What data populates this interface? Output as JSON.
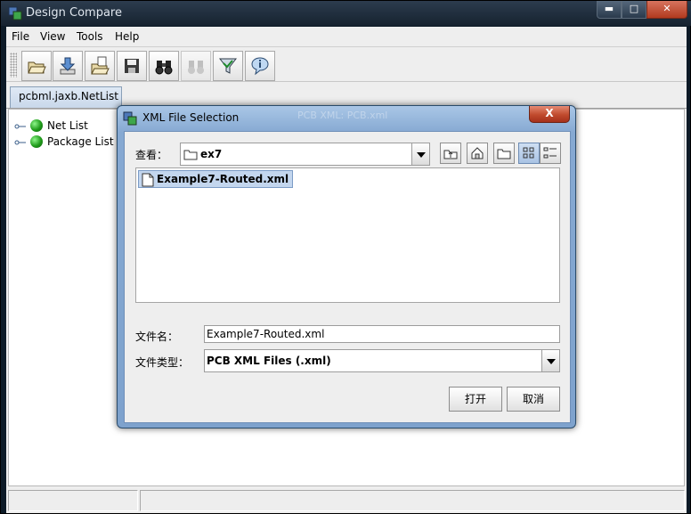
{
  "window": {
    "title": "Design Compare"
  },
  "menu": [
    "File",
    "View",
    "Tools",
    "Help"
  ],
  "toolbar": {
    "buttons": [
      {
        "icon": "open-folder-icon"
      },
      {
        "icon": "download-icon"
      },
      {
        "icon": "open-folder-with-file-icon"
      },
      {
        "icon": "save-icon"
      },
      {
        "icon": "binoculars-icon"
      },
      {
        "icon": "binoculars-disabled-icon"
      },
      {
        "icon": "compare-filter-icon"
      },
      {
        "icon": "help-speech-bubble-icon"
      }
    ]
  },
  "tabs": [
    {
      "label": "pcbml.jaxb.NetList"
    }
  ],
  "tree": {
    "items": [
      {
        "label": "Net List"
      },
      {
        "label": "Package List"
      }
    ]
  },
  "dialog": {
    "title": "XML File Selection",
    "ghost_title": "PCB XML: PCB.xml",
    "close_label": "X",
    "look_in_label": "查看：",
    "look_in_value": "ex7",
    "files": [
      {
        "name": "Example7-Routed.xml"
      }
    ],
    "filename_label": "文件名：",
    "filename_value": "Example7-Routed.xml",
    "filetype_label": "文件类型：",
    "filetype_value": "PCB XML Files (.xml)",
    "open_label": "打开",
    "cancel_label": "取消"
  },
  "colors": {
    "titlebar_dark": "#16222f",
    "dialog_frame": "#86a9d2",
    "selection": "#c3d6ee",
    "node_green": "#1f9b1a"
  }
}
